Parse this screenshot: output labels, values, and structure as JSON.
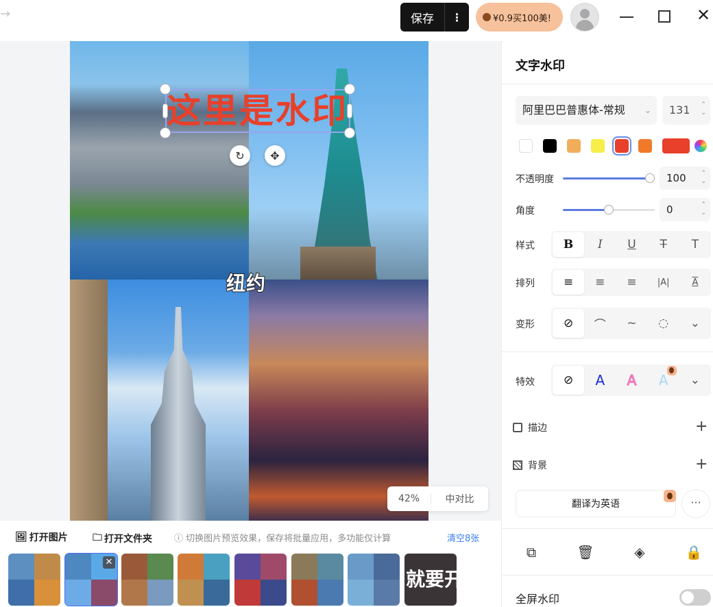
{
  "topbar": {
    "back_glyph": "→",
    "save_label": "保存",
    "more_glyph": "⋮",
    "promo_label": "¥0.9买100美!",
    "minimize_glyph": "",
    "close_glyph": "✕"
  },
  "canvas": {
    "watermark_text": "这里是水印",
    "watermark_color": "#e8402a",
    "image_caption": "纽约",
    "zoom": "42%",
    "compare_label": "中对比"
  },
  "bottom": {
    "open_image": "打开图片",
    "open_folder": "打开文件夹",
    "hint": "ⓘ 切换图片预览效果，保存将批量应用，多功能仅计算",
    "clear": "清空8张",
    "last_thumb_text": "就要开"
  },
  "panel": {
    "title": "文字水印",
    "font": "阿里巴巴普惠体-常规",
    "font_size": "131",
    "colors": [
      "#ffffff",
      "#000000",
      "#f2ad5a",
      "#f6ee4a",
      "#e8402a",
      "#f07a2a"
    ],
    "selected_color": "#e8402a",
    "opacity_label": "不透明度",
    "opacity_value": "100",
    "opacity_fraction": 1.0,
    "angle_label": "角度",
    "angle_value": "0",
    "angle_fraction": 0.5,
    "style_label": "样式",
    "style_items": [
      "B",
      "I",
      "U",
      "T",
      "T"
    ],
    "arrange_label": "排列",
    "transform_label": "变形",
    "effect_label": "特效",
    "effect_glyph": "A",
    "stroke_label": "描边",
    "background_label": "背景",
    "translate_label": "翻译为英语",
    "more_glyph": "···",
    "fullscreen_label": "全屏水印",
    "fullscreen_on": false
  }
}
